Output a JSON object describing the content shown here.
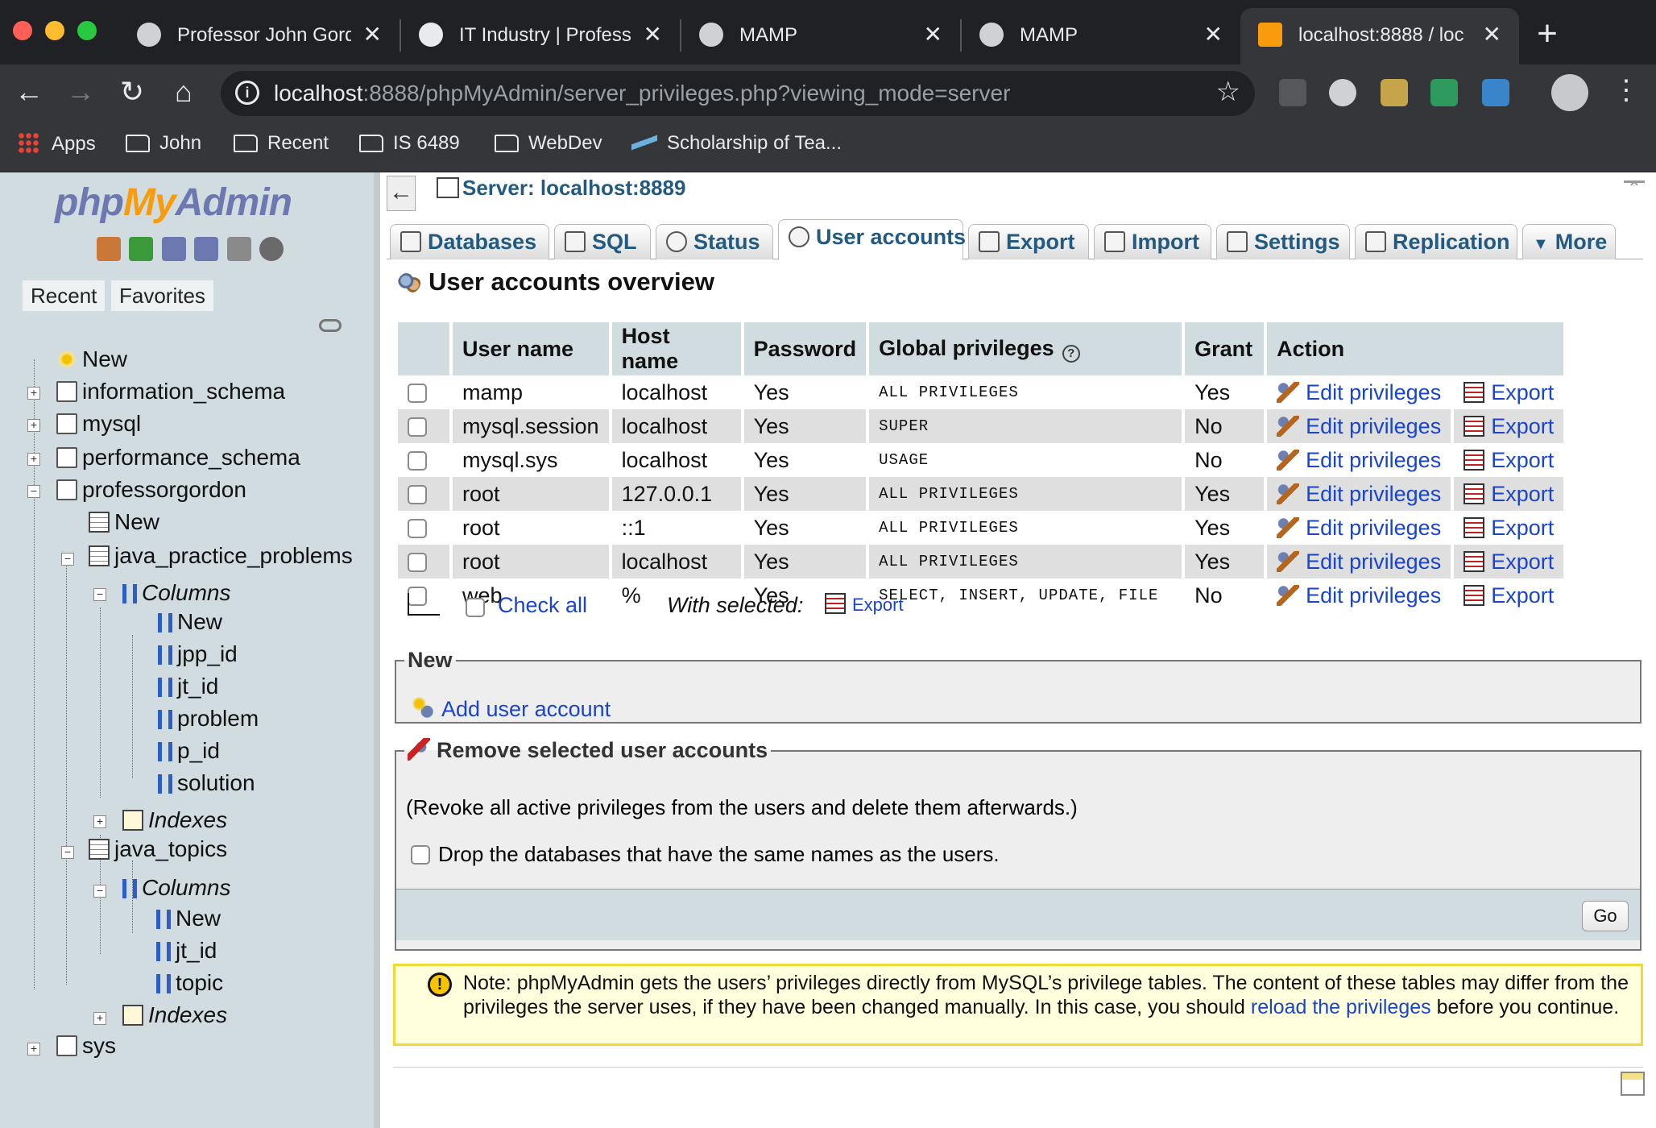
{
  "browser": {
    "tabs": [
      {
        "title": "Professor John Gord"
      },
      {
        "title": "IT Industry | Profess"
      },
      {
        "title": "MAMP"
      },
      {
        "title": "MAMP"
      },
      {
        "title": "localhost:8888 / loc"
      }
    ],
    "url_host": "localhost",
    "url_rest": ":8888/phpMyAdmin/server_privileges.php?viewing_mode=server",
    "bookmarks": [
      "Apps",
      "John",
      "Recent",
      "IS 6489",
      "WebDev",
      "Scholarship of Tea..."
    ]
  },
  "sidebar": {
    "logo": {
      "php": "php",
      "my": "My",
      "admin": "Admin"
    },
    "recent_tab": "Recent",
    "favorites_tab": "Favorites",
    "tree": {
      "new": "New",
      "dbs": [
        "information_schema",
        "mysql",
        "performance_schema",
        "professorgordon"
      ],
      "pg_new": "New",
      "table1": "java_practice_problems",
      "columns_label": "Columns",
      "table1_cols": [
        "New",
        "jpp_id",
        "jt_id",
        "problem",
        "p_id",
        "solution"
      ],
      "indexes_label": "Indexes",
      "table2": "java_topics",
      "table2_cols": [
        "New",
        "jt_id",
        "topic"
      ],
      "sys": "sys"
    }
  },
  "main": {
    "server": "Server: localhost:8889",
    "menu": [
      "Databases",
      "SQL",
      "Status",
      "User accounts",
      "Export",
      "Import",
      "Settings",
      "Replication",
      "More"
    ],
    "title": "User accounts overview",
    "table": {
      "headers": [
        "User name",
        "Host name",
        "Password",
        "Global privileges",
        "Grant",
        "Action"
      ],
      "rows": [
        {
          "user": "mamp",
          "host": "localhost",
          "password": "Yes",
          "privileges": "ALL PRIVILEGES",
          "grant": "Yes"
        },
        {
          "user": "mysql.session",
          "host": "localhost",
          "password": "Yes",
          "privileges": "SUPER",
          "grant": "No"
        },
        {
          "user": "mysql.sys",
          "host": "localhost",
          "password": "Yes",
          "privileges": "USAGE",
          "grant": "No"
        },
        {
          "user": "root",
          "host": "127.0.0.1",
          "password": "Yes",
          "privileges": "ALL PRIVILEGES",
          "grant": "Yes"
        },
        {
          "user": "root",
          "host": "::1",
          "password": "Yes",
          "privileges": "ALL PRIVILEGES",
          "grant": "Yes"
        },
        {
          "user": "root",
          "host": "localhost",
          "password": "Yes",
          "privileges": "ALL PRIVILEGES",
          "grant": "Yes"
        },
        {
          "user": "web",
          "host": "%",
          "password": "Yes",
          "privileges": "SELECT, INSERT, UPDATE, FILE",
          "grant": "No"
        }
      ],
      "edit_label": "Edit privileges",
      "export_label": "Export"
    },
    "check_all": "Check all",
    "with_selected": "With selected:",
    "with_selected_export": "Export",
    "new_legend": "New",
    "add_user": "Add user account",
    "remove_legend": "Remove selected user accounts",
    "revoke_text": "(Revoke all active privileges from the users and delete them afterwards.)",
    "drop_text": "Drop the databases that have the same names as the users.",
    "go": "Go",
    "note_before": "Note: phpMyAdmin gets the users’ privileges directly from MySQL’s privilege tables. The content of these tables may differ from the privileges the server uses, if they have been changed manually. In this case, you should ",
    "note_link": "reload the privileges",
    "note_after": " before you continue."
  }
}
